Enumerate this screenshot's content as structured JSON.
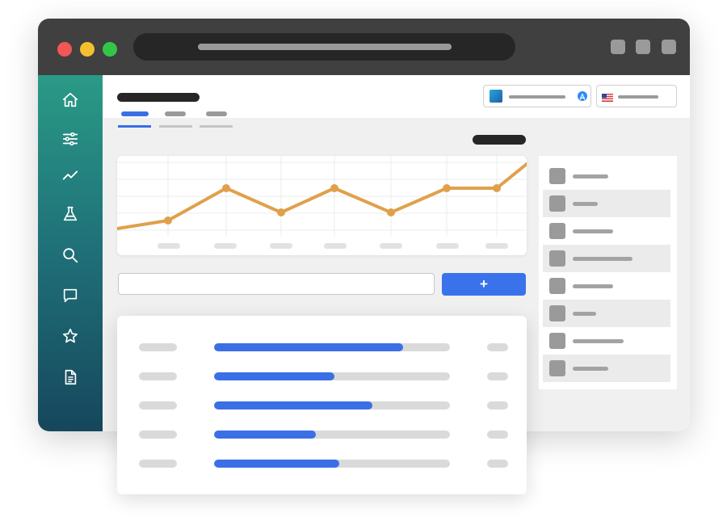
{
  "window": {
    "traffic_lights": [
      {
        "name": "close",
        "color": "#f25756"
      },
      {
        "name": "minimize",
        "color": "#f5c02f"
      },
      {
        "name": "zoom",
        "color": "#33c748"
      }
    ]
  },
  "sidebar": {
    "items": [
      {
        "icon": "home-icon"
      },
      {
        "icon": "sliders-icon"
      },
      {
        "icon": "trend-icon"
      },
      {
        "icon": "flask-icon"
      },
      {
        "icon": "search-icon"
      },
      {
        "icon": "chat-icon"
      },
      {
        "icon": "star-icon"
      },
      {
        "icon": "document-icon"
      }
    ]
  },
  "header": {
    "app_selector_icon": "app-store-icon",
    "country_selector_icon": "us-flag-icon"
  },
  "tabs": [
    {
      "active": true
    },
    {
      "active": false
    },
    {
      "active": false
    }
  ],
  "colors": {
    "accent": "#3a72ec",
    "chart_line": "#e0a04b",
    "sidebar_top": "#2a9a86",
    "sidebar_bottom": "#16475c"
  },
  "chart_data": {
    "type": "line",
    "series": [
      {
        "values": [
          1,
          2,
          6,
          3,
          6,
          3,
          6,
          6,
          9
        ]
      }
    ],
    "grid": true
  },
  "add_button": {
    "label": "+"
  },
  "rank_list": {
    "rows": [
      {
        "progress": 0.8
      },
      {
        "progress": 0.51
      },
      {
        "progress": 0.67
      },
      {
        "progress": 0.43
      },
      {
        "progress": 0.53
      }
    ]
  },
  "side_panel": {
    "items": [
      {
        "alt": false
      },
      {
        "alt": true
      },
      {
        "alt": false
      },
      {
        "alt": true
      },
      {
        "alt": false
      },
      {
        "alt": true
      },
      {
        "alt": false
      },
      {
        "alt": true
      }
    ]
  }
}
